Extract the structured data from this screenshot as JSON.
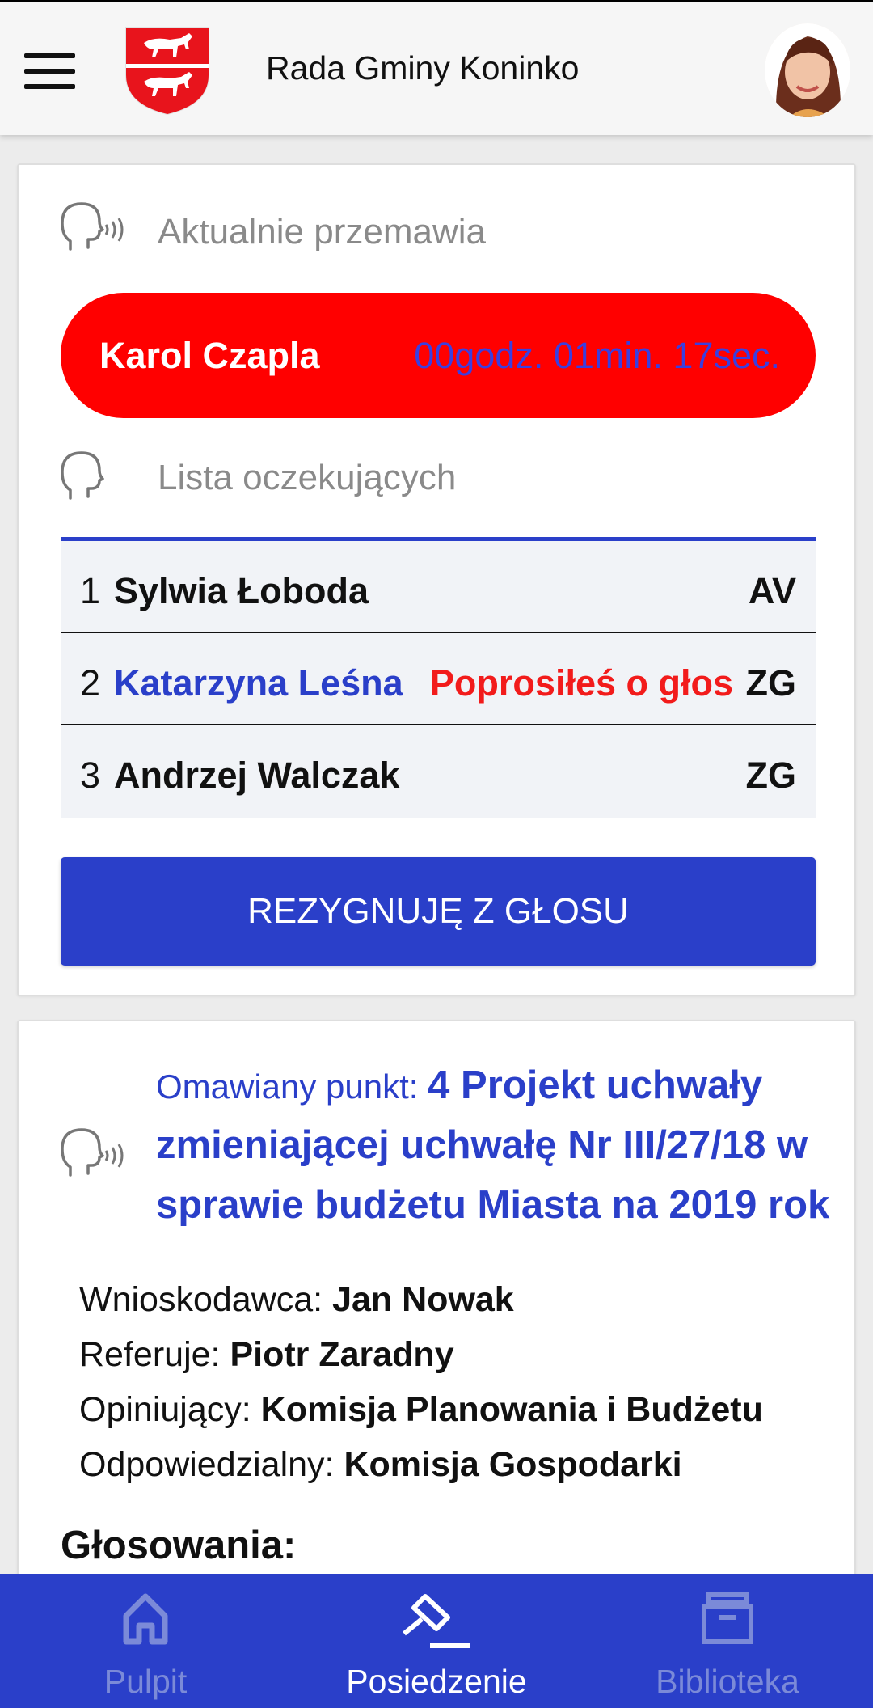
{
  "app": {
    "title": "Rada Gminy Koninko"
  },
  "speaking": {
    "section_label": "Aktualnie przemawia",
    "speaker_name": "Karol Czapla",
    "elapsed": "00godz. 01min. 17sec."
  },
  "queue": {
    "section_label": "Lista oczekujących",
    "rows": [
      {
        "num": "1",
        "name": "Sylwia Łoboda",
        "request": "",
        "club": "AV"
      },
      {
        "num": "2",
        "name": "Katarzyna Leśna",
        "request": "Poprosiłeś o głos",
        "club": "ZG"
      },
      {
        "num": "3",
        "name": "Andrzej Walczak",
        "request": "",
        "club": "ZG"
      }
    ],
    "resign_label": "REZYGNUJĘ Z GŁOSU"
  },
  "agenda": {
    "prefix": "Omawiany punkt: ",
    "title": "4 Projekt uchwały zmieniającej uchwałę Nr III/27/18 w sprawie budżetu Miasta na 2019 rok",
    "details": [
      {
        "label": "Wnioskodawca: ",
        "value": "Jan Nowak"
      },
      {
        "label": "Referuje: ",
        "value": "Piotr Zaradny"
      },
      {
        "label": "Opiniujący: ",
        "value": "Komisja Planowania i Budżetu"
      },
      {
        "label": "Odpowiedzialny: ",
        "value": "Komisja Gospodarki"
      }
    ],
    "votes_heading": "Głosowania:"
  },
  "nav": {
    "items": [
      {
        "label": "Pulpit",
        "icon": "home-icon",
        "active": false
      },
      {
        "label": "Posiedzenie",
        "icon": "gavel-icon",
        "active": true
      },
      {
        "label": "Biblioteka",
        "icon": "archive-icon",
        "active": false
      }
    ]
  },
  "colors": {
    "primary": "#2a3fc9",
    "speaker_bg": "#ff0000",
    "request_text": "#f21b1b",
    "muted_text": "#8a8a8a",
    "inactive_nav": "#7b8ad8"
  }
}
